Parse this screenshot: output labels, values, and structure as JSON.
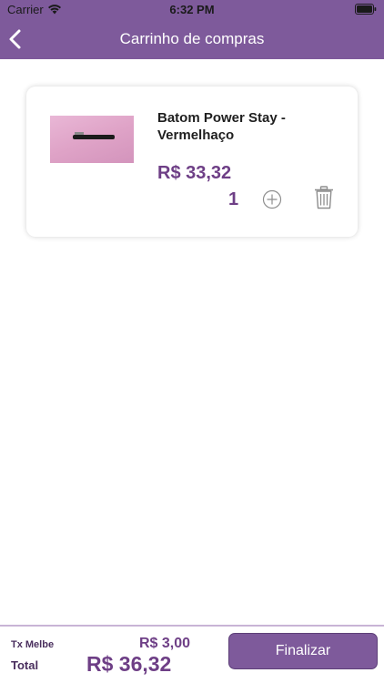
{
  "status_bar": {
    "carrier": "Carrier",
    "time": "6:32 PM"
  },
  "nav": {
    "title": "Carrinho de compras",
    "back_icon": "chevron-left-icon"
  },
  "cart": {
    "items": [
      {
        "name": "Batom Power Stay - Vermelhaço",
        "price": "R$ 33,32",
        "quantity": "1"
      }
    ]
  },
  "footer": {
    "fee_label": "Tx Melbe",
    "fee_value": "R$ 3,00",
    "total_label": "Total",
    "total_value": "R$ 36,32",
    "checkout_label": "Finalizar"
  },
  "colors": {
    "brand_purple": "#7e5a9b",
    "price_purple": "#6e3f86"
  }
}
